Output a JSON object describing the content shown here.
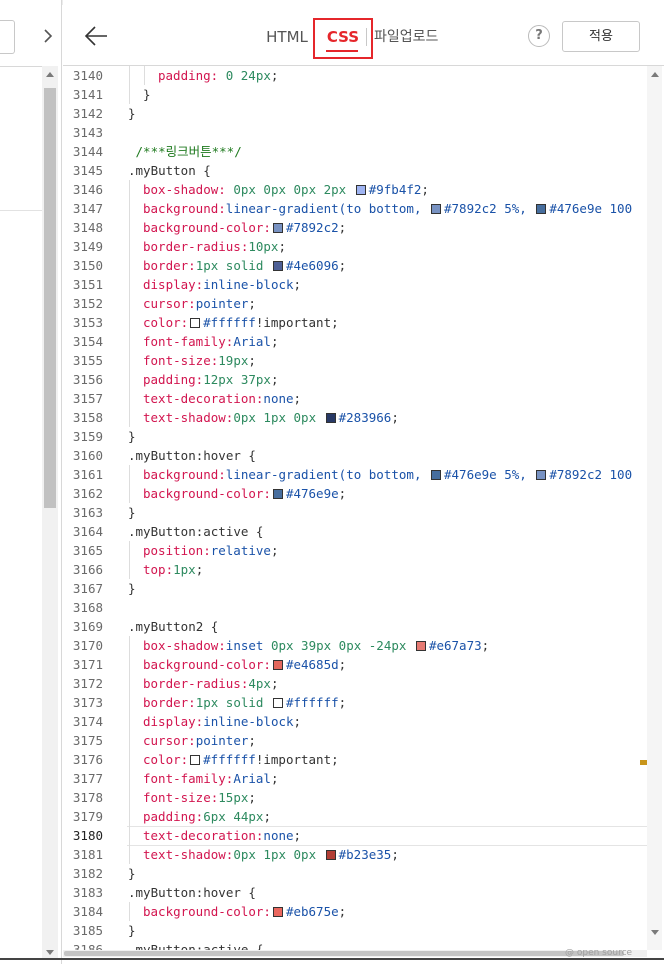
{
  "header": {
    "tabs": [
      {
        "label": "HTML"
      },
      {
        "label": "CSS"
      },
      {
        "label": "파일업로드"
      }
    ],
    "help_label": "?",
    "apply_label": "적용"
  },
  "footer": {
    "open_source_label": "@ open source"
  },
  "editor": {
    "active_line": 3180,
    "lines": [
      {
        "n": "3140",
        "indent": 2,
        "tokens": [
          [
            "padding: ",
            "prop"
          ],
          [
            "0 24px",
            "num"
          ],
          [
            ";",
            "sel"
          ]
        ]
      },
      {
        "n": "3141",
        "indent": 1,
        "tokens": [
          [
            "}",
            "brace"
          ]
        ]
      },
      {
        "n": "3142",
        "indent": 0,
        "tokens": [
          [
            "}",
            "brace"
          ]
        ]
      },
      {
        "n": "3143",
        "indent": 0,
        "tokens": []
      },
      {
        "n": "3144",
        "indent": 0,
        "tokens": [
          [
            " /***링크버튼***/",
            "cmt"
          ]
        ]
      },
      {
        "n": "3145",
        "indent": 0,
        "tokens": [
          [
            ".myButton {",
            "sel"
          ]
        ]
      },
      {
        "n": "3146",
        "indent": 1,
        "tokens": [
          [
            "box-shadow: ",
            "prop"
          ],
          [
            "0px 0px 0px 2px ",
            "num"
          ],
          [
            "#9fb4f2",
            "swatch"
          ],
          [
            "#9fb4f2",
            "val"
          ],
          [
            ";",
            "sel"
          ]
        ]
      },
      {
        "n": "3147",
        "indent": 1,
        "tokens": [
          [
            "background:",
            "prop"
          ],
          [
            "linear-gradient(to bottom, ",
            "val"
          ],
          [
            "#7892c2",
            "swatch"
          ],
          [
            "#7892c2 5%, ",
            "val"
          ],
          [
            "#476e9e",
            "swatch"
          ],
          [
            "#476e9e 100",
            "val"
          ]
        ]
      },
      {
        "n": "3148",
        "indent": 1,
        "tokens": [
          [
            "background-color:",
            "prop"
          ],
          [
            "#7892c2",
            "swatch"
          ],
          [
            "#7892c2",
            "val"
          ],
          [
            ";",
            "sel"
          ]
        ]
      },
      {
        "n": "3149",
        "indent": 1,
        "tokens": [
          [
            "border-radius:",
            "prop"
          ],
          [
            "10px",
            "num"
          ],
          [
            ";",
            "sel"
          ]
        ]
      },
      {
        "n": "3150",
        "indent": 1,
        "tokens": [
          [
            "border:",
            "prop"
          ],
          [
            "1px solid ",
            "num"
          ],
          [
            "#4e6096",
            "swatch"
          ],
          [
            "#4e6096",
            "val"
          ],
          [
            ";",
            "sel"
          ]
        ]
      },
      {
        "n": "3151",
        "indent": 1,
        "tokens": [
          [
            "display:",
            "prop"
          ],
          [
            "inline-block",
            "val"
          ],
          [
            ";",
            "sel"
          ]
        ]
      },
      {
        "n": "3152",
        "indent": 1,
        "tokens": [
          [
            "cursor:",
            "prop"
          ],
          [
            "pointer",
            "val"
          ],
          [
            ";",
            "sel"
          ]
        ]
      },
      {
        "n": "3153",
        "indent": 1,
        "tokens": [
          [
            "color:",
            "prop"
          ],
          [
            "#ffffff",
            "swatch"
          ],
          [
            "#ffffff",
            "val"
          ],
          [
            "!important",
            "imp"
          ],
          [
            ";",
            "sel"
          ]
        ]
      },
      {
        "n": "3154",
        "indent": 1,
        "tokens": [
          [
            "font-family:",
            "prop"
          ],
          [
            "Arial",
            "val"
          ],
          [
            ";",
            "sel"
          ]
        ]
      },
      {
        "n": "3155",
        "indent": 1,
        "tokens": [
          [
            "font-size:",
            "prop"
          ],
          [
            "19px",
            "num"
          ],
          [
            ";",
            "sel"
          ]
        ]
      },
      {
        "n": "3156",
        "indent": 1,
        "tokens": [
          [
            "padding:",
            "prop"
          ],
          [
            "12px 37px",
            "num"
          ],
          [
            ";",
            "sel"
          ]
        ]
      },
      {
        "n": "3157",
        "indent": 1,
        "tokens": [
          [
            "text-decoration:",
            "prop"
          ],
          [
            "none",
            "val"
          ],
          [
            ";",
            "sel"
          ]
        ]
      },
      {
        "n": "3158",
        "indent": 1,
        "tokens": [
          [
            "text-shadow:",
            "prop"
          ],
          [
            "0px 1px 0px ",
            "num"
          ],
          [
            "#283966",
            "swatch"
          ],
          [
            "#283966",
            "val"
          ],
          [
            ";",
            "sel"
          ]
        ]
      },
      {
        "n": "3159",
        "indent": 0,
        "tokens": [
          [
            "}",
            "brace"
          ]
        ]
      },
      {
        "n": "3160",
        "indent": 0,
        "tokens": [
          [
            ".myButton:hover {",
            "sel"
          ]
        ]
      },
      {
        "n": "3161",
        "indent": 1,
        "tokens": [
          [
            "background:",
            "prop"
          ],
          [
            "linear-gradient(to bottom, ",
            "val"
          ],
          [
            "#476e9e",
            "swatch"
          ],
          [
            "#476e9e 5%, ",
            "val"
          ],
          [
            "#7892c2",
            "swatch"
          ],
          [
            "#7892c2 100",
            "val"
          ]
        ]
      },
      {
        "n": "3162",
        "indent": 1,
        "tokens": [
          [
            "background-color:",
            "prop"
          ],
          [
            "#476e9e",
            "swatch"
          ],
          [
            "#476e9e",
            "val"
          ],
          [
            ";",
            "sel"
          ]
        ]
      },
      {
        "n": "3163",
        "indent": 0,
        "tokens": [
          [
            "}",
            "brace"
          ]
        ]
      },
      {
        "n": "3164",
        "indent": 0,
        "tokens": [
          [
            ".myButton:active {",
            "sel"
          ]
        ]
      },
      {
        "n": "3165",
        "indent": 1,
        "tokens": [
          [
            "position:",
            "prop"
          ],
          [
            "relative",
            "val"
          ],
          [
            ";",
            "sel"
          ]
        ]
      },
      {
        "n": "3166",
        "indent": 1,
        "tokens": [
          [
            "top:",
            "prop"
          ],
          [
            "1px",
            "num"
          ],
          [
            ";",
            "sel"
          ]
        ]
      },
      {
        "n": "3167",
        "indent": 0,
        "tokens": [
          [
            "}",
            "brace"
          ]
        ]
      },
      {
        "n": "3168",
        "indent": 0,
        "tokens": []
      },
      {
        "n": "3169",
        "indent": 0,
        "tokens": [
          [
            ".myButton2 {",
            "sel"
          ]
        ]
      },
      {
        "n": "3170",
        "indent": 1,
        "tokens": [
          [
            "box-shadow:",
            "prop"
          ],
          [
            "inset ",
            "val"
          ],
          [
            "0px 39px 0px -24px ",
            "num"
          ],
          [
            "#e67a73",
            "swatch"
          ],
          [
            "#e67a73",
            "val"
          ],
          [
            ";",
            "sel"
          ]
        ]
      },
      {
        "n": "3171",
        "indent": 1,
        "tokens": [
          [
            "background-color:",
            "prop"
          ],
          [
            "#e4685d",
            "swatch"
          ],
          [
            "#e4685d",
            "val"
          ],
          [
            ";",
            "sel"
          ]
        ]
      },
      {
        "n": "3172",
        "indent": 1,
        "tokens": [
          [
            "border-radius:",
            "prop"
          ],
          [
            "4px",
            "num"
          ],
          [
            ";",
            "sel"
          ]
        ]
      },
      {
        "n": "3173",
        "indent": 1,
        "tokens": [
          [
            "border:",
            "prop"
          ],
          [
            "1px solid ",
            "num"
          ],
          [
            "#ffffff",
            "swatch"
          ],
          [
            "#ffffff",
            "val"
          ],
          [
            ";",
            "sel"
          ]
        ]
      },
      {
        "n": "3174",
        "indent": 1,
        "tokens": [
          [
            "display:",
            "prop"
          ],
          [
            "inline-block",
            "val"
          ],
          [
            ";",
            "sel"
          ]
        ]
      },
      {
        "n": "3175",
        "indent": 1,
        "tokens": [
          [
            "cursor:",
            "prop"
          ],
          [
            "pointer",
            "val"
          ],
          [
            ";",
            "sel"
          ]
        ]
      },
      {
        "n": "3176",
        "indent": 1,
        "tokens": [
          [
            "color:",
            "prop"
          ],
          [
            "#ffffff",
            "swatch"
          ],
          [
            "#ffffff",
            "val"
          ],
          [
            "!important",
            "imp"
          ],
          [
            ";",
            "sel"
          ]
        ]
      },
      {
        "n": "3177",
        "indent": 1,
        "tokens": [
          [
            "font-family:",
            "prop"
          ],
          [
            "Arial",
            "val"
          ],
          [
            ";",
            "sel"
          ]
        ]
      },
      {
        "n": "3178",
        "indent": 1,
        "tokens": [
          [
            "font-size:",
            "prop"
          ],
          [
            "15px",
            "num"
          ],
          [
            ";",
            "sel"
          ]
        ]
      },
      {
        "n": "3179",
        "indent": 1,
        "tokens": [
          [
            "padding:",
            "prop"
          ],
          [
            "6px 44px",
            "num"
          ],
          [
            ";",
            "sel"
          ]
        ]
      },
      {
        "n": "3180",
        "indent": 1,
        "tokens": [
          [
            "text-decoration:",
            "prop"
          ],
          [
            "none",
            "val"
          ],
          [
            ";",
            "sel"
          ]
        ]
      },
      {
        "n": "3181",
        "indent": 1,
        "tokens": [
          [
            "text-shadow:",
            "prop"
          ],
          [
            "0px 1px 0px ",
            "num"
          ],
          [
            "#b23e35",
            "swatch"
          ],
          [
            "#b23e35",
            "val"
          ],
          [
            ";",
            "sel"
          ]
        ]
      },
      {
        "n": "3182",
        "indent": 0,
        "tokens": [
          [
            "}",
            "brace"
          ]
        ]
      },
      {
        "n": "3183",
        "indent": 0,
        "tokens": [
          [
            ".myButton:hover {",
            "sel"
          ]
        ]
      },
      {
        "n": "3184",
        "indent": 1,
        "tokens": [
          [
            "background-color:",
            "prop"
          ],
          [
            "#eb675e",
            "swatch"
          ],
          [
            "#eb675e",
            "val"
          ],
          [
            ";",
            "sel"
          ]
        ]
      },
      {
        "n": "3185",
        "indent": 0,
        "tokens": [
          [
            "}",
            "brace"
          ]
        ]
      },
      {
        "n": "3186",
        "indent": 0,
        "tokens": [
          [
            ".myButton:active {",
            "sel"
          ]
        ]
      }
    ]
  }
}
